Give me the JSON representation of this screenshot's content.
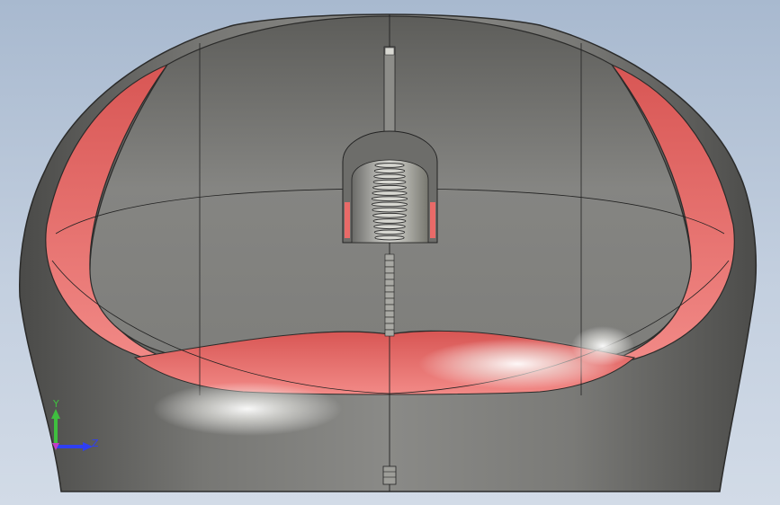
{
  "viewport": {
    "background_top": "#a8b9cf",
    "background_bottom": "#d2dbe7"
  },
  "model": {
    "body_color": "#6e6e6b",
    "accent_color": "#e96a68"
  },
  "triad": {
    "y_label": "Y",
    "z_label": "Z",
    "y_color": "#3fbf3f",
    "z_color": "#2f3ff2"
  }
}
